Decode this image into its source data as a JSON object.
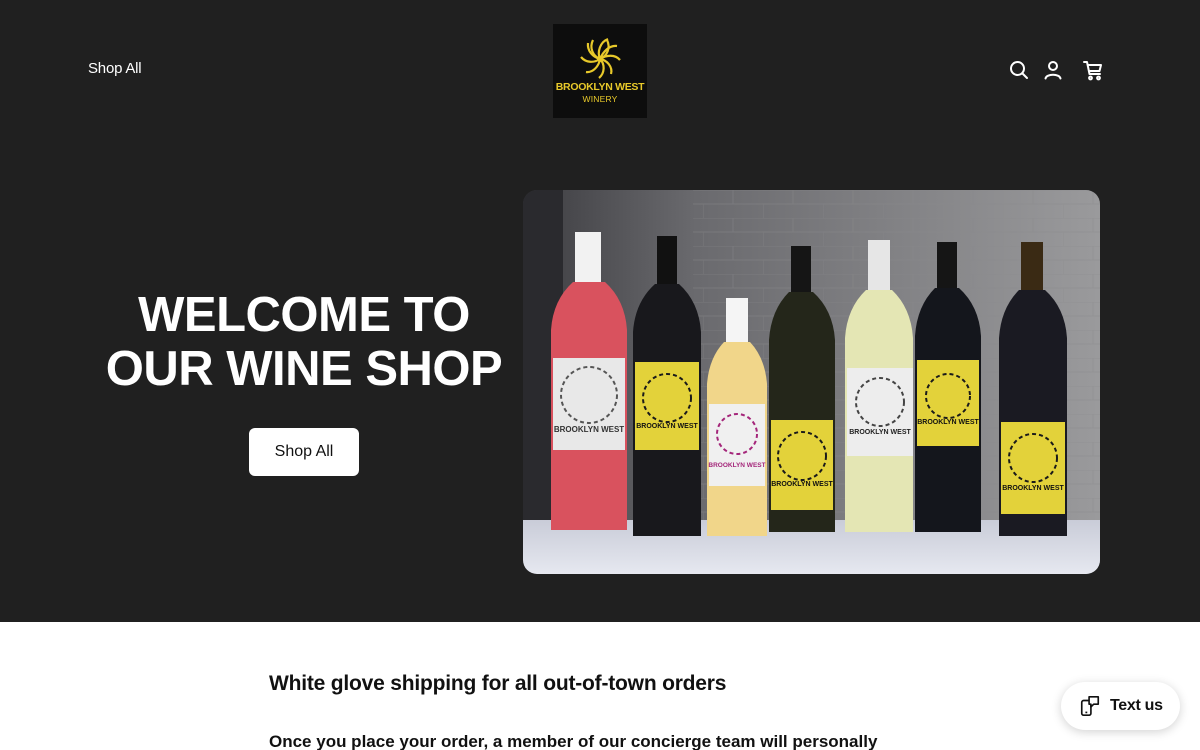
{
  "header": {
    "nav_link": "Shop All",
    "logo": {
      "line1": "BROOKLYN WEST",
      "line2": "WINERY",
      "color": "#e8c92a"
    },
    "icons": [
      "search-icon",
      "account-icon",
      "cart-icon"
    ]
  },
  "hero": {
    "title": "WELCOME TO OUR WINE SHOP",
    "button_label": "Shop All",
    "image": {
      "alt": "Brooklyn West Winery wine bottles",
      "bottle_label_brand": "BROOKLYN WEST"
    }
  },
  "content": {
    "heading": "White glove shipping for all out-of-town orders",
    "body": "Once you place your order, a member of our concierge team will personally"
  },
  "widget": {
    "label": "Text us",
    "icon": "phone-chat-icon"
  },
  "colors": {
    "hero_background": "#202020",
    "accent_yellow": "#e8c92a",
    "page_background": "#ffffff"
  }
}
